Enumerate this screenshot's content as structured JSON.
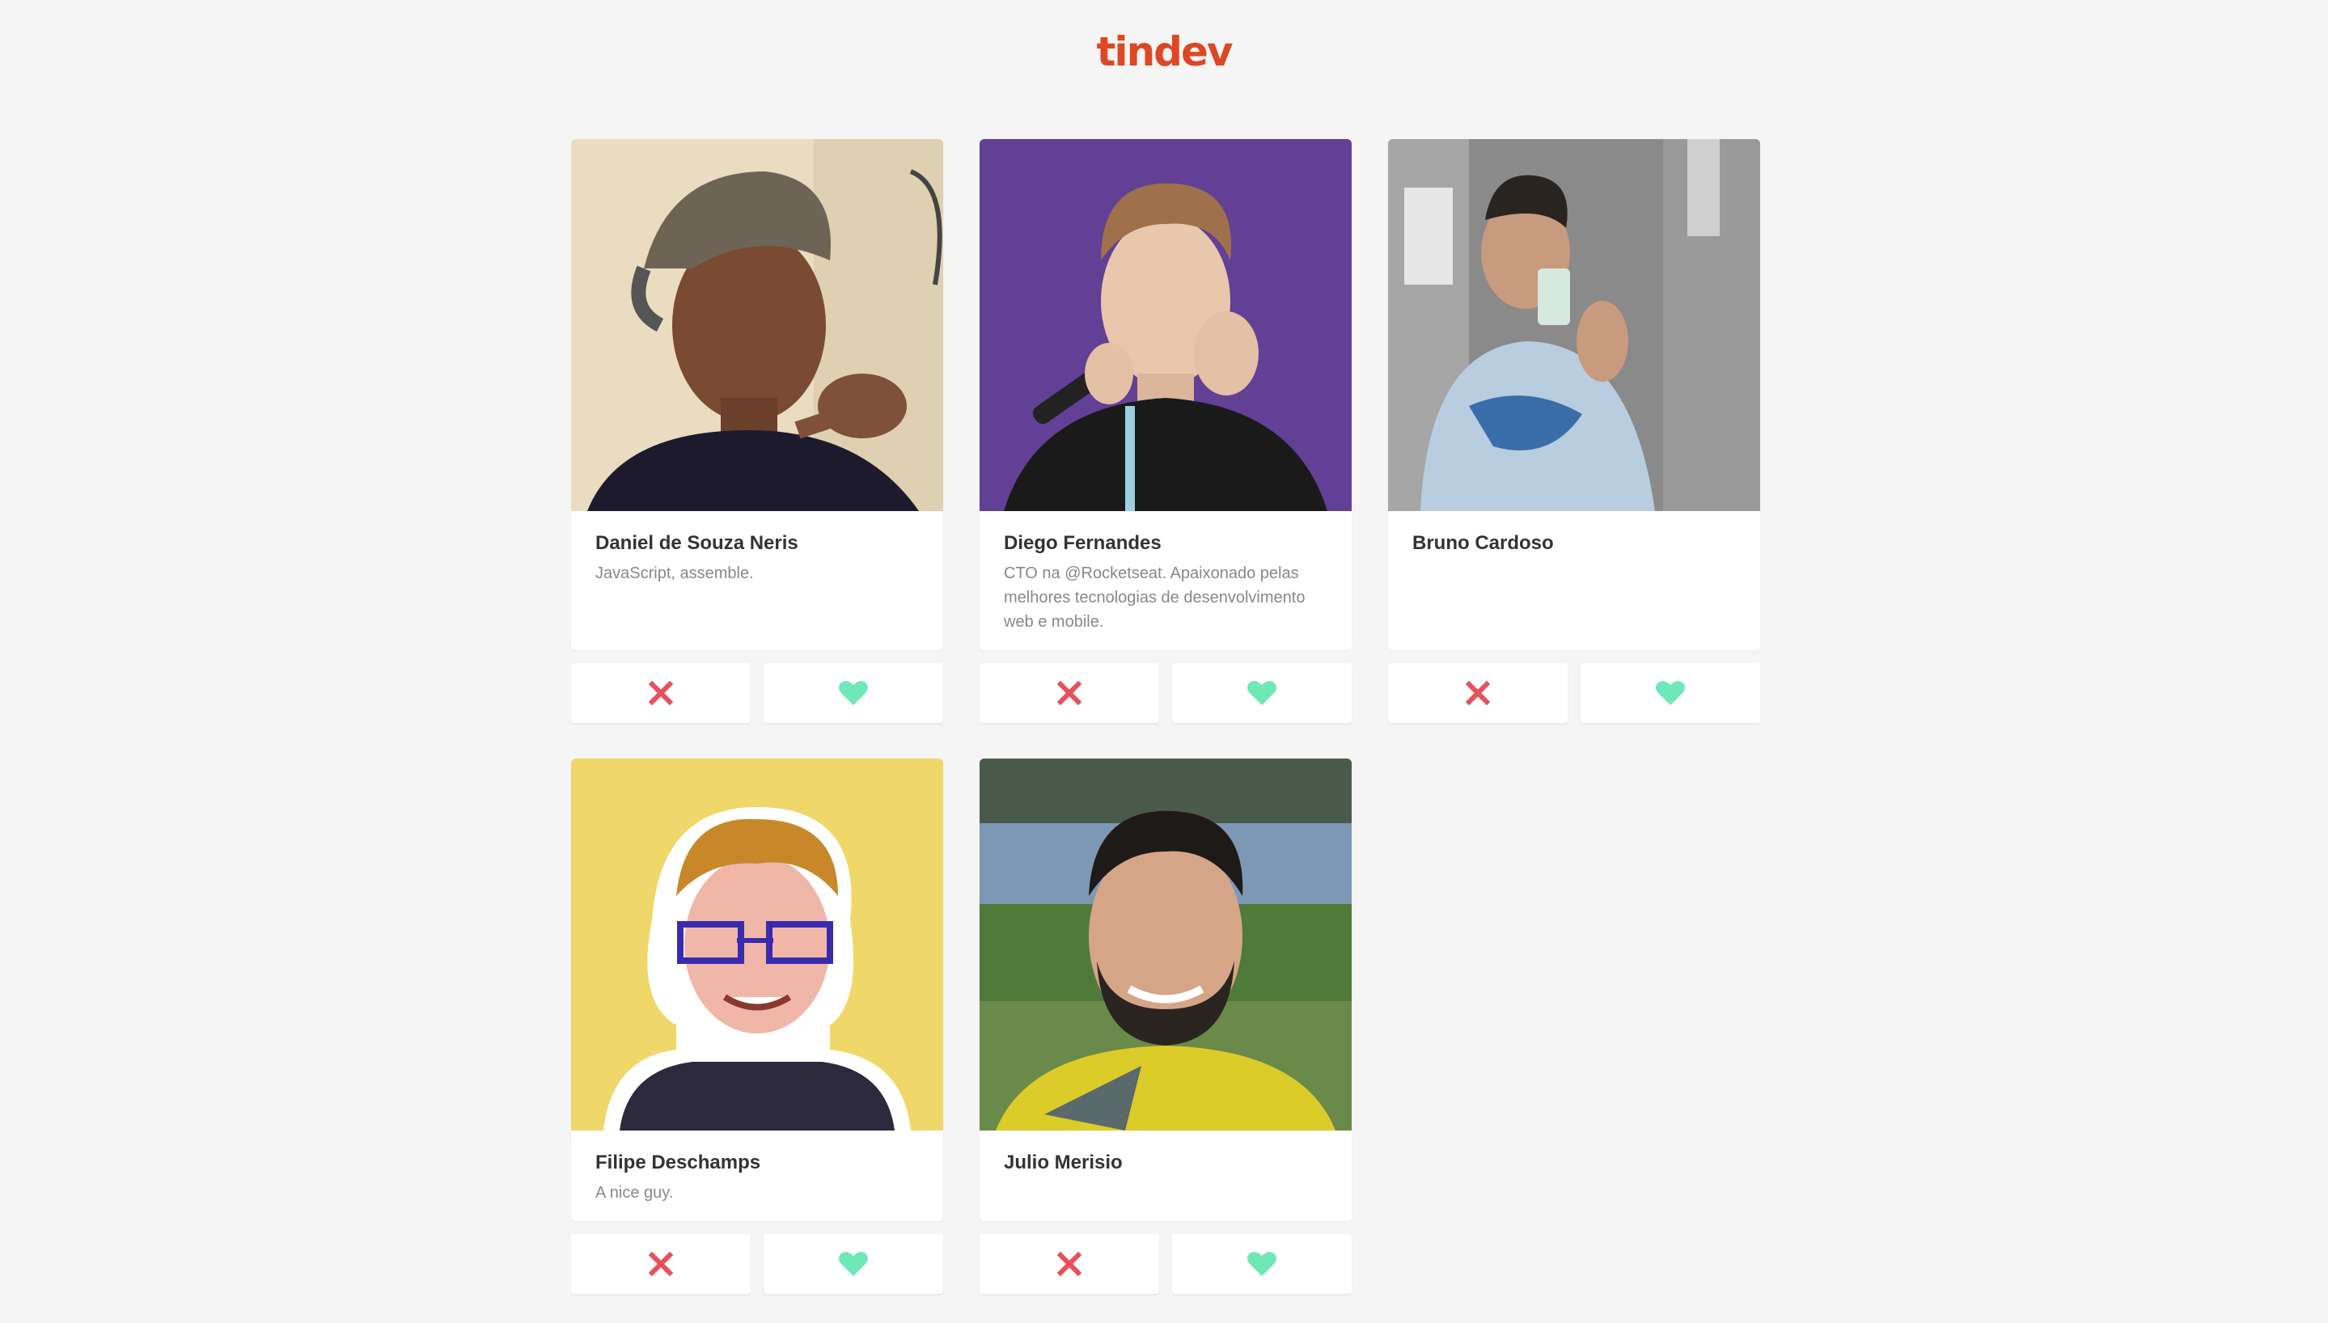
{
  "app": {
    "logo_text": "tindev",
    "logo_color": "#df4723"
  },
  "colors": {
    "dislike": "#e9505b",
    "like": "#6ee8b6",
    "background": "#f5f5f5"
  },
  "devs": [
    {
      "name": "Daniel de Souza Neris",
      "bio": "JavaScript, assemble.",
      "photo": "photo-daniel"
    },
    {
      "name": "Diego Fernandes",
      "bio": "CTO na @Rocketseat. Apaixonado pelas melhores tecnologias de desenvolvimento web e mobile.",
      "photo": "photo-diego"
    },
    {
      "name": "Bruno Cardoso",
      "bio": "",
      "photo": "photo-bruno"
    },
    {
      "name": "Filipe Deschamps",
      "bio": "A nice guy.",
      "photo": "photo-filipe"
    },
    {
      "name": "Julio Merisio",
      "bio": "",
      "photo": "photo-julio"
    }
  ],
  "actions": {
    "dislike_icon": "close-icon",
    "like_icon": "heart-icon"
  }
}
